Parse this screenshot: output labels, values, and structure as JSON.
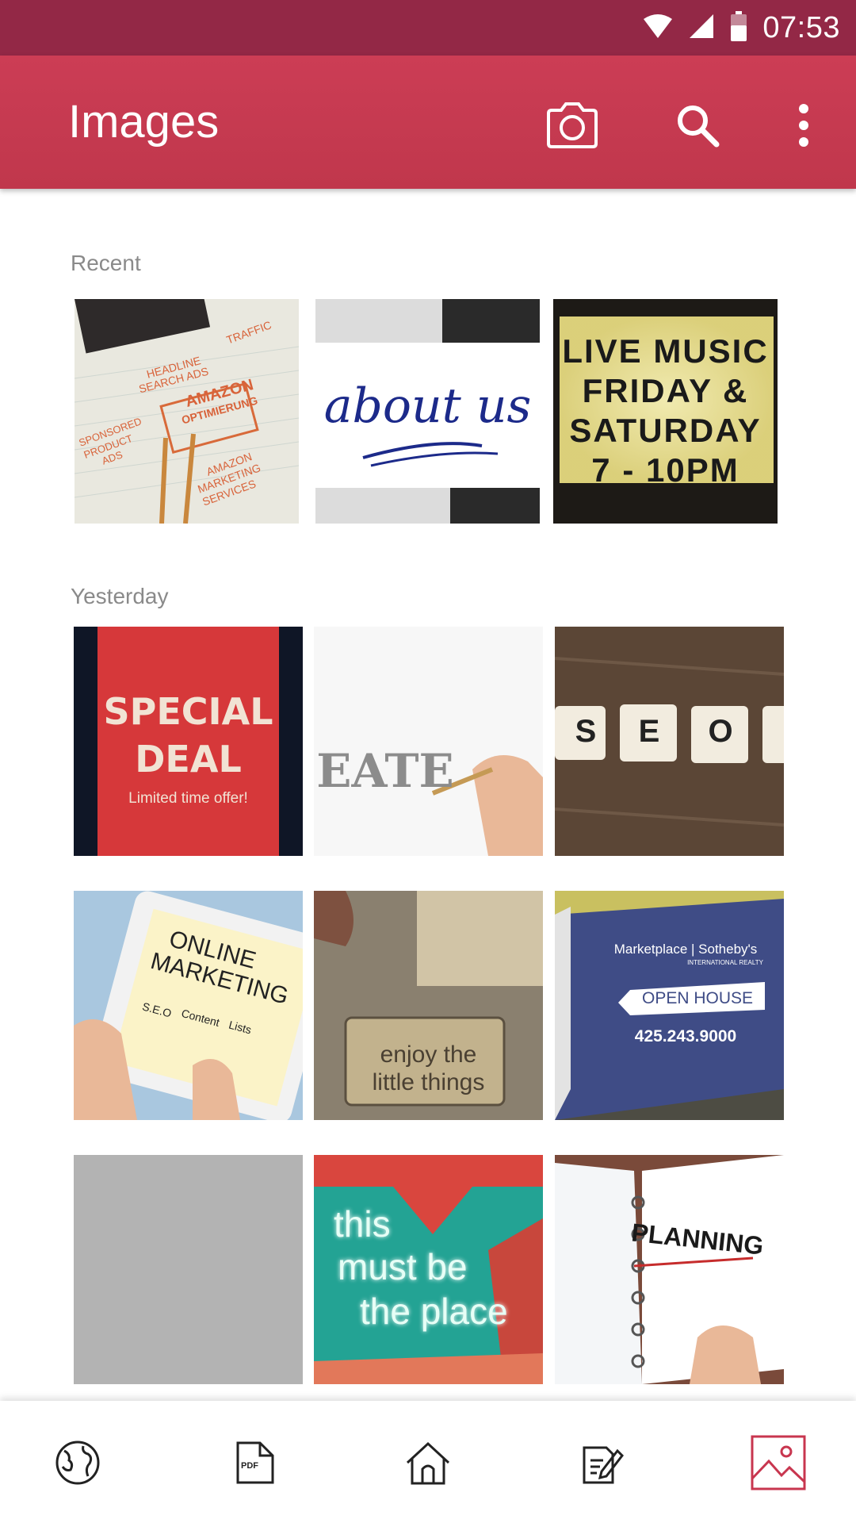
{
  "status_bar": {
    "time": "07:53",
    "icons": [
      "wifi-icon",
      "cell-signal-icon",
      "battery-icon"
    ]
  },
  "app_bar": {
    "title": "Images",
    "actions": [
      "camera-icon",
      "search-icon",
      "more-vert-icon"
    ]
  },
  "colors": {
    "status_bar": "#932846",
    "app_bar": "#c53a50",
    "accent": "#c8364f",
    "section_label": "#8a8a8a",
    "placeholder": "#b3b3b3"
  },
  "sections": {
    "recent": {
      "label": "Recent",
      "items": [
        {
          "name": "marketing-notebook",
          "lines": [
            "AMAZON",
            "OPTIMIERUNG",
            "HEADLINE",
            "SEARCH ADS",
            "TRAFFIC",
            "SPONSORED",
            "PRODUCT ADS",
            "AMAZON",
            "MARKETING",
            "SERVICES"
          ]
        },
        {
          "name": "about-us",
          "lines": [
            "about us"
          ]
        },
        {
          "name": "live-music-sign",
          "lines": [
            "LIVE MUSIC",
            "FRIDAY &",
            "SATURDAY",
            "7 - 10PM"
          ]
        }
      ]
    },
    "yesterday": {
      "label": "Yesterday",
      "items": [
        {
          "name": "special-deal",
          "lines": [
            "SPECIAL",
            "DEAL",
            "Limited time offer!"
          ]
        },
        {
          "name": "create-pencil",
          "lines": [
            "EATE"
          ]
        },
        {
          "name": "seo-tiles",
          "lines": [
            "S",
            "E",
            "O"
          ]
        },
        {
          "name": "online-marketing-tablet",
          "lines": [
            "ONLINE",
            "MARKETING",
            "S.E.O",
            "Content",
            "Lists"
          ]
        },
        {
          "name": "enjoy-little-things",
          "lines": [
            "enjoy the",
            "little things"
          ]
        },
        {
          "name": "open-house-sign",
          "lines": [
            "Marketplace | Sotheby's",
            "INTERNATIONAL REALTY",
            "OPEN HOUSE",
            "425.243.9000"
          ]
        },
        {
          "name": "blank-placeholder",
          "lines": []
        },
        {
          "name": "neon-sign",
          "lines": [
            "this",
            "must be",
            "the place"
          ]
        },
        {
          "name": "planning-notebook",
          "lines": [
            "PLANNING"
          ]
        }
      ]
    }
  },
  "bottom_nav": [
    {
      "icon": "globe-icon",
      "label": ""
    },
    {
      "icon": "pdf-file-icon",
      "label": "PDF"
    },
    {
      "icon": "home-icon",
      "label": ""
    },
    {
      "icon": "edit-document-icon",
      "label": ""
    },
    {
      "icon": "image-icon",
      "label": "",
      "active": true
    }
  ]
}
